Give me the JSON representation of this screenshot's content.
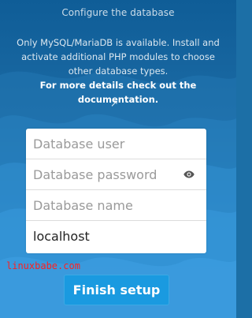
{
  "header": {
    "title": "Configure the database"
  },
  "info": {
    "line1": "Only MySQL/MariaDB is available. Install and",
    "line2": "activate additional PHP modules to choose",
    "line3": "other database types.",
    "line4": "For more details check out the documentation.",
    "link_icon": "↗"
  },
  "form": {
    "db_user_placeholder": "Database user",
    "db_password_placeholder": "Database password",
    "db_name_placeholder": "Database name",
    "db_host_value": "localhost",
    "show_password_icon": "eye-icon"
  },
  "watermark": {
    "text": "linuxbabe.com"
  },
  "actions": {
    "finish_label": "Finish setup"
  },
  "colors": {
    "background": "#1c6fa6",
    "button": "#1a9ae0",
    "watermark": "#ff1f1f"
  }
}
